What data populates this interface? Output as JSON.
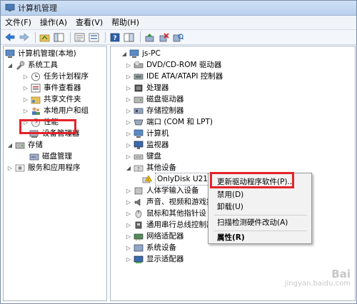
{
  "window": {
    "title": "计算机管理"
  },
  "menubar": {
    "items": [
      "文件(F)",
      "操作(A)",
      "查看(V)",
      "帮助(H)"
    ]
  },
  "left_tree": {
    "root": "计算机管理(本地)",
    "items": [
      {
        "label": "系统工具",
        "level": 1
      },
      {
        "label": "任务计划程序",
        "level": 2
      },
      {
        "label": "事件查看器",
        "level": 2
      },
      {
        "label": "共享文件夹",
        "level": 2
      },
      {
        "label": "本地用户和组",
        "level": 2
      },
      {
        "label": "性能",
        "level": 2
      },
      {
        "label": "设备管理器",
        "level": 2
      },
      {
        "label": "存储",
        "level": 1
      },
      {
        "label": "磁盘管理",
        "level": 2
      },
      {
        "label": "服务和应用程序",
        "level": 1
      }
    ]
  },
  "device_tree": {
    "root": "js-PC",
    "items": [
      "DVD/CD-ROM 驱动器",
      "IDE ATA/ATAPI 控制器",
      "处理器",
      "磁盘驱动器",
      "存储控制器",
      "端口 (COM 和 LPT)",
      "计算机",
      "监视器",
      "键盘",
      "其他设备",
      "OnlyDisk U210",
      "人体学输入设备",
      "声音、视频和游戏控",
      "鼠标和其他指针设",
      "通用串行总线控制器",
      "网络适配器",
      "系统设备",
      "显示适配器"
    ]
  },
  "context_menu": {
    "items": [
      "更新驱动程序软件(P)...",
      "禁用(D)",
      "卸载(U)",
      "扫描检测硬件改动(A)",
      "属性(R)"
    ]
  },
  "watermark": {
    "line1": "Bai",
    "line2": "jingyan.baidu.com"
  },
  "colors": {
    "highlight": "#e5222a",
    "titlebar": "#cfe0f5"
  }
}
